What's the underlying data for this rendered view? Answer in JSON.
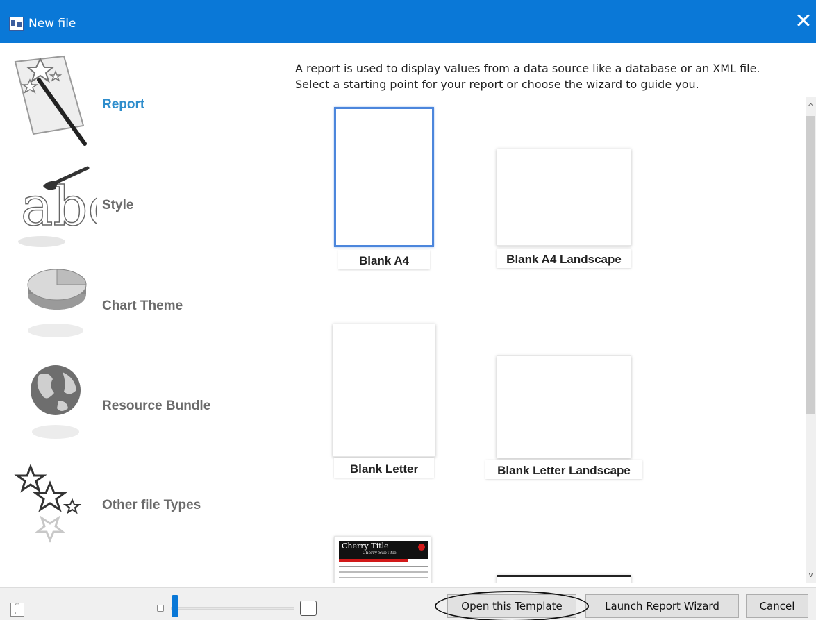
{
  "window": {
    "title": "New file"
  },
  "categories": [
    {
      "label": "Report",
      "icon": "report-icon",
      "selected": true
    },
    {
      "label": "Style",
      "icon": "style-icon"
    },
    {
      "label": "Chart Theme",
      "icon": "chart-theme-icon"
    },
    {
      "label": "Resource Bundle",
      "icon": "globe-icon"
    },
    {
      "label": "Other file Types",
      "icon": "stars-icon"
    }
  ],
  "description": {
    "line1": "A report is used to display values from a data source like a database or an XML file.",
    "line2": "Select a starting point for your report or choose the wizard to guide you."
  },
  "templates": [
    {
      "label": "Blank A4",
      "selected": true
    },
    {
      "label": "Blank A4 Landscape"
    },
    {
      "label": "Blank Letter"
    },
    {
      "label": "Blank Letter Landscape"
    },
    {
      "label": "Cherry Title",
      "preview_title": "Cherry Title",
      "preview_subtitle": "Cherry SubTitle"
    }
  ],
  "buttons": {
    "open_template": "Open this Template",
    "launch_wizard": "Launch Report Wizard",
    "cancel": "Cancel"
  },
  "colors": {
    "accent": "#0a78d7",
    "selected_label": "#2e8dcc",
    "selection_border": "#4c86dc"
  }
}
